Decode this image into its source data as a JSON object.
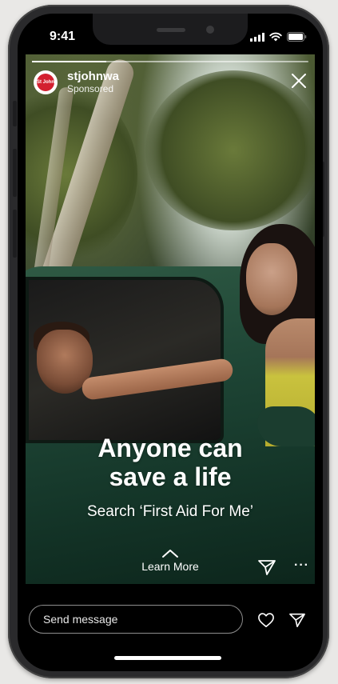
{
  "status_bar": {
    "time": "9:41"
  },
  "story": {
    "progress": 0.27,
    "account_name": "stjohnwa",
    "account_subtitle": "Sponsored",
    "avatar_text": "St John",
    "headline_line1": "Anyone can",
    "headline_line2": "save a life",
    "subline": "Search ‘First Aid For Me’",
    "cta_label": "Learn More",
    "more_label": "···"
  },
  "reply": {
    "placeholder": "Send message"
  },
  "colors": {
    "brand_red": "#d32030",
    "background": "#000000"
  },
  "icons": [
    "signal-icon",
    "wifi-icon",
    "battery-icon",
    "close-icon",
    "chevron-up-icon",
    "share-icon",
    "more-icon",
    "heart-icon",
    "send-icon"
  ]
}
